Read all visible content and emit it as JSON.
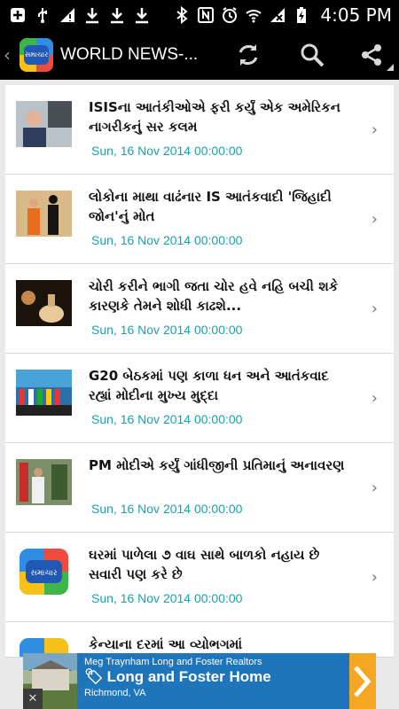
{
  "status_bar": {
    "time": "4:05 PM",
    "icons": [
      "plus-square-icon",
      "usb-icon",
      "no-signal-icon",
      "download-icon",
      "download-icon",
      "download-icon",
      "bluetooth-icon",
      "nfc-icon",
      "alarm-icon",
      "wifi-icon",
      "no-sim-icon",
      "battery-charging-icon"
    ]
  },
  "app_bar": {
    "logo_text": "સમાચાર",
    "title": "WORLD NEWS-...",
    "actions": [
      "refresh-icon",
      "search-icon",
      "share-icon"
    ]
  },
  "articles": [
    {
      "headline": "ISISના આતંકીઓએ ફરી કર્યું એક અમેરિકન નાગરીકનું સર કલમ",
      "date": "Sun, 16 Nov 2014 00:00:00",
      "thumb": "man-photo"
    },
    {
      "headline": "લોકોના માથા વાઢંનાર IS આતંકવાદી 'જિહાદી જોન'નું મોત",
      "date": "Sun, 16 Nov 2014 00:00:00",
      "thumb": "jihadi-photo"
    },
    {
      "headline": "ચોરી કરીને ભાગી જતા ચોર હવે નહિ બચી શકે કારણકે તેમને શોધી કાઢશે...",
      "date": "Sun, 16 Nov 2014 00:00:00",
      "thumb": "perfume-photo"
    },
    {
      "headline": "G20 બેઠકમાં પણ કાળા ધન અને આતંકવાદ રહ્યાં મોદીના મુખ્ય મુદ્દા",
      "date": "Sun, 16 Nov 2014 00:00:00",
      "thumb": "g20-photo"
    },
    {
      "headline": "PM મોદીએ કર્યું ગાંધીજીની પ્રતિમાનું અનાવરણ",
      "date": "Sun, 16 Nov 2014 00:00:00",
      "thumb": "statue-photo"
    },
    {
      "headline": "ઘરમાં પાળેલા ૭ વાઘ સાથે બાળકો નહાય છે સવારી પણ કરે છે",
      "date": "Sun, 16 Nov 2014 00:00:00",
      "thumb": "app-logo"
    },
    {
      "headline": "કેન્યાના દરમાં આ વ્યોભગમાં",
      "date": "",
      "thumb": "app-logo"
    }
  ],
  "ad": {
    "sponsor": "Meg Traynham Long and Foster Realtors",
    "headline": "Long and Foster Home",
    "location": "Richmond, VA",
    "close": "✕"
  }
}
